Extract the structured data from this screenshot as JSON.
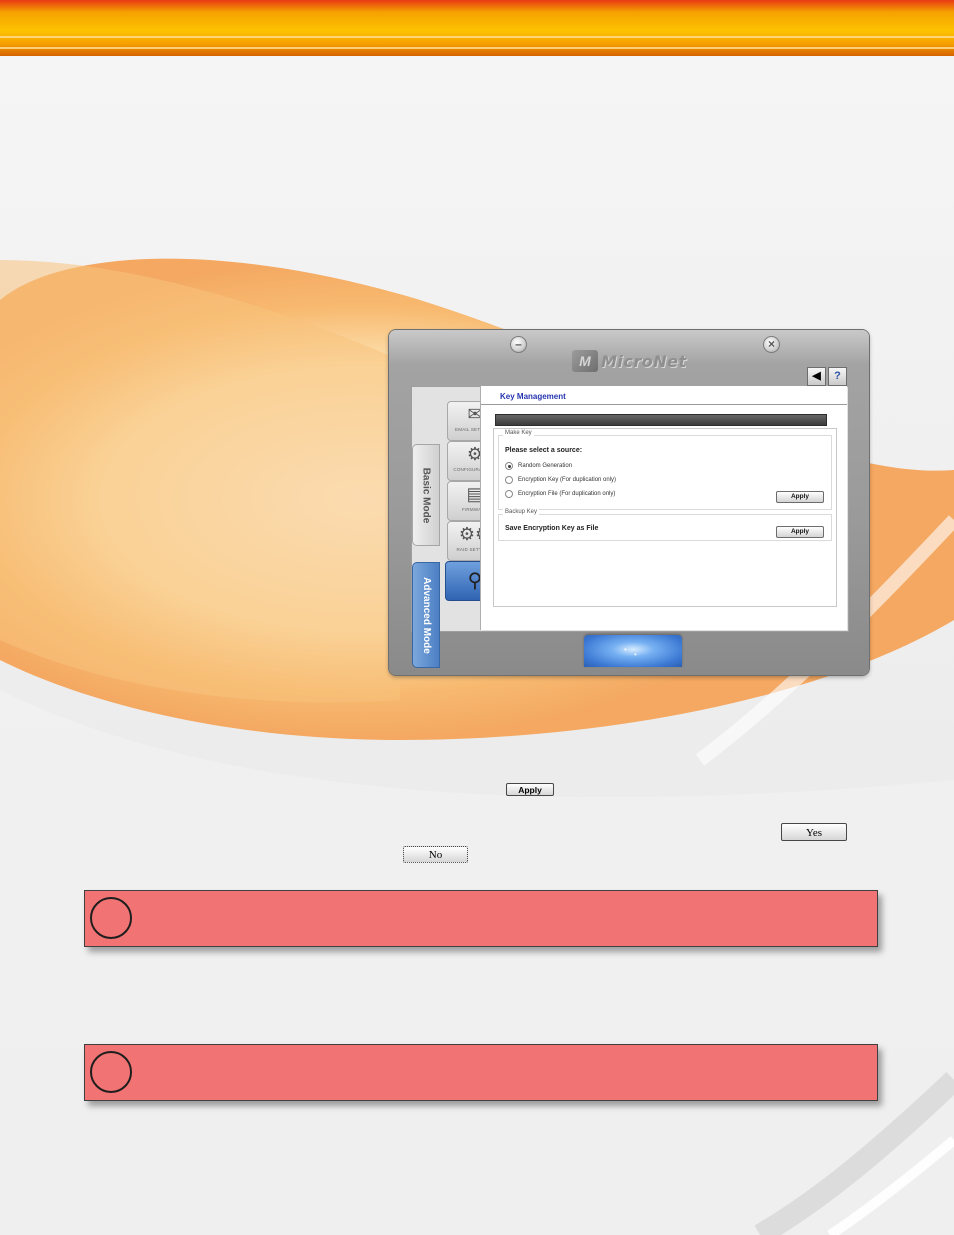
{
  "app": {
    "logo_text": "MicroNet",
    "logo_mark": "M",
    "minimize_icon": "minimize-icon",
    "close_icon": "close-icon",
    "speaker_icon": "speaker-icon",
    "help_icon": "help-icon",
    "help_glyph": "?",
    "speaker_glyph": "◀",
    "mode_tabs": {
      "basic": "Basic Mode",
      "advanced": "Advanced Mode"
    },
    "sidebar": {
      "items": [
        {
          "label": "EMAIL SETTINGS",
          "icon": "email-icon",
          "glyph": "✉"
        },
        {
          "label": "CONFIGURATIONS",
          "icon": "gear-icon",
          "glyph": "⚙"
        },
        {
          "label": "FIRMWARE",
          "icon": "firmware-icon",
          "glyph": "▤"
        },
        {
          "label": "RAID SETTINGS",
          "icon": "gears-icon",
          "glyph": "⚙⚙"
        },
        {
          "label": "",
          "icon": "key-icon",
          "glyph": "⚲"
        }
      ]
    },
    "content": {
      "title": "Key Management",
      "make_key": {
        "legend": "Make Key",
        "prompt": "Please select a source:",
        "options": [
          {
            "label": "Random Generation",
            "checked": true
          },
          {
            "label": "Encryption Key (For duplication only)",
            "checked": false
          },
          {
            "label": "Encryption File (For duplication only)",
            "checked": false
          }
        ],
        "apply_label": "Apply"
      },
      "backup_key": {
        "legend": "Backup Key",
        "label": "Save Encryption Key as File",
        "apply_label": "Apply"
      }
    }
  },
  "inline_buttons": {
    "apply": "Apply",
    "yes": "Yes",
    "no": "No"
  },
  "colors": {
    "header_orange": "#f5a300",
    "note_red": "#f17373",
    "advanced_blue": "#4c7fc4",
    "title_blue": "#2535b0"
  }
}
